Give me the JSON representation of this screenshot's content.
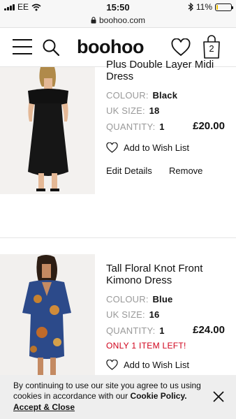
{
  "status_bar": {
    "carrier": "EE",
    "time": "15:50",
    "battery": "11%",
    "battery_level": 0.11
  },
  "browser": {
    "url": "boohoo.com"
  },
  "header": {
    "logo": "boohoo",
    "bag_count": "2"
  },
  "products": [
    {
      "title": "Plus Double Layer Midi Dress",
      "colour_label": "COLOUR:",
      "colour": "Black",
      "size_label": "UK SIZE:",
      "size": "18",
      "quantity_label": "QUANTITY:",
      "quantity": "1",
      "price": "£20.00",
      "wishlist_label": "Add to Wish List",
      "edit_label": "Edit Details",
      "remove_label": "Remove"
    },
    {
      "title": "Tall Floral Knot Front Kimono Dress",
      "colour_label": "COLOUR:",
      "colour": "Blue",
      "size_label": "UK SIZE:",
      "size": "16",
      "quantity_label": "QUANTITY:",
      "quantity": "1",
      "price": "£24.00",
      "stock_notice": "ONLY 1 ITEM LEFT!",
      "wishlist_label": "Add to Wish List"
    }
  ],
  "cookie_banner": {
    "text": "By continuing to use our site you agree to us using cookies in accordance with our",
    "policy_link": "Cookie Policy.",
    "accept_label": "Accept & Close"
  },
  "colors": {
    "price_alert": "#d0021b",
    "label_gray": "#999999",
    "banner_bg": "#eeeeee"
  }
}
